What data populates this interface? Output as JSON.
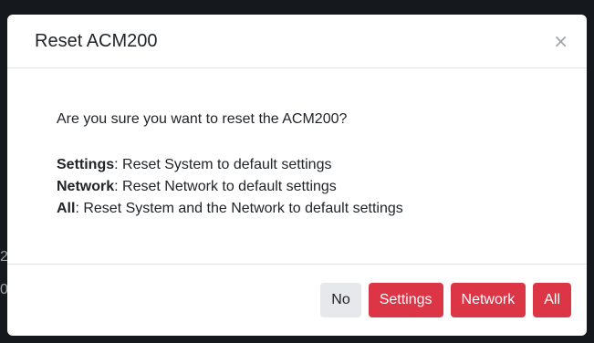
{
  "background": {
    "edge_chars": [
      "2",
      "0"
    ]
  },
  "modal": {
    "title": "Reset ACM200",
    "close_glyph": "×",
    "question": "Are you sure you want to reset the ACM200?",
    "options": [
      {
        "term": "Settings",
        "description": ": Reset System to default settings"
      },
      {
        "term": "Network",
        "description": ": Reset Network to default settings"
      },
      {
        "term": "All",
        "description": ": Reset System and the Network to default settings"
      }
    ],
    "buttons": {
      "no_label": "No",
      "settings_label": "Settings",
      "network_label": "Network",
      "all_label": "All"
    }
  },
  "colors": {
    "danger": "#dc3545",
    "light": "#e6e8eb",
    "backdrop": "#15191e"
  }
}
